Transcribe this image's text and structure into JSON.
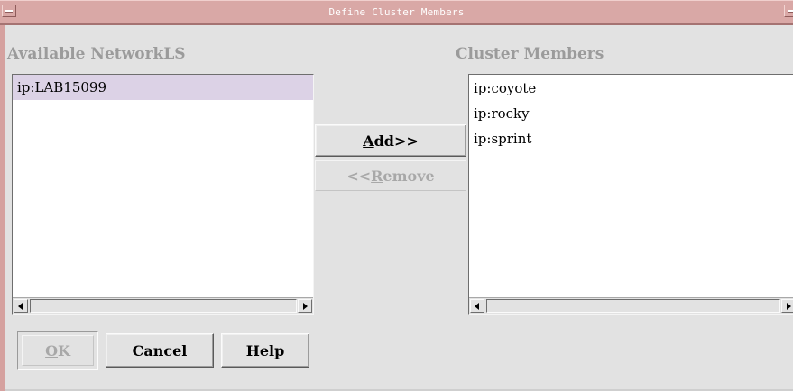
{
  "window": {
    "title": "Define Cluster Members"
  },
  "available": {
    "heading": "Available NetworkLS",
    "items": [
      "ip:LAB15099"
    ],
    "selected_index": 0
  },
  "members": {
    "heading": "Cluster Members",
    "items": [
      "ip:coyote",
      "ip:rocky",
      "ip:sprint"
    ]
  },
  "transfer": {
    "add_label": "Add>>",
    "add_mnemonic": "A",
    "add_rest": "dd>>",
    "remove_label": "<<Remove",
    "remove_prefix": "<<",
    "remove_mnemonic": "R",
    "remove_rest": "emove",
    "remove_enabled": false
  },
  "footer": {
    "ok_label": "OK",
    "ok_mnemonic": "O",
    "ok_rest": "K",
    "ok_enabled": false,
    "cancel_label": "Cancel",
    "help_label": "Help"
  },
  "colors": {
    "titlebar": "#d9a8a6",
    "background": "#e2e2e2",
    "selection": "#dcd2e6",
    "heading_text": "#9b9b9b",
    "disabled_text": "#a8a8a8"
  }
}
